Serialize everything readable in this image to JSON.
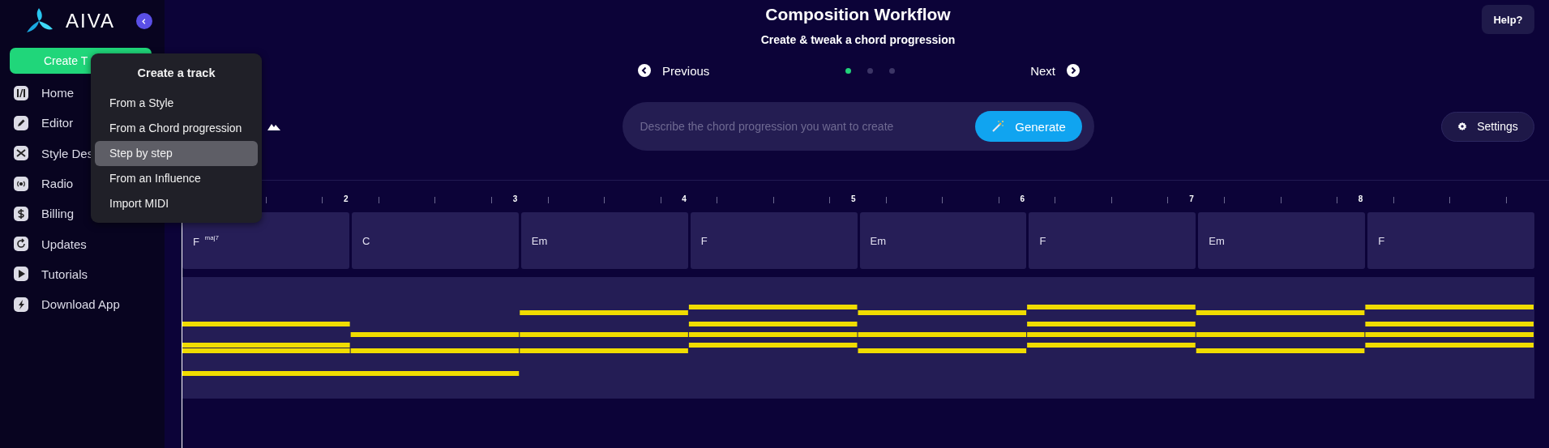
{
  "sidebar": {
    "brand": "AIVA",
    "create_button": "Create T",
    "items": [
      {
        "label": "Home"
      },
      {
        "label": "Editor"
      },
      {
        "label": "Style Des"
      },
      {
        "label": "Radio"
      },
      {
        "label": "Billing"
      },
      {
        "label": "Updates"
      },
      {
        "label": "Tutorials"
      },
      {
        "label": "Download App"
      }
    ]
  },
  "create_menu": {
    "title": "Create a track",
    "items": [
      {
        "label": "From a Style",
        "selected": false
      },
      {
        "label": "From a Chord progression",
        "selected": false
      },
      {
        "label": "Step by step",
        "selected": true
      },
      {
        "label": "From an Influence",
        "selected": false
      },
      {
        "label": "Import MIDI",
        "selected": false
      }
    ]
  },
  "header": {
    "title": "Composition Workflow",
    "subtitle": "Create & tweak a chord progression",
    "help_button": "Help?"
  },
  "wizard_nav": {
    "previous": "Previous",
    "next": "Next",
    "steps": [
      {
        "selected": true
      },
      {
        "selected": false
      },
      {
        "selected": false
      }
    ]
  },
  "prompt": {
    "placeholder": "Describe the chord progression you want to create",
    "generate_button": "Generate"
  },
  "settings_button": "Settings",
  "ruler": [
    "2",
    "3",
    "4",
    "5",
    "6",
    "7",
    "8"
  ],
  "chords": [
    {
      "name": "F $^{maj7}$"
    },
    {
      "name": "C"
    },
    {
      "name": "Em"
    },
    {
      "name": "F"
    },
    {
      "name": "Em"
    },
    {
      "name": "F"
    },
    {
      "name": "Em"
    },
    {
      "name": "F"
    }
  ]
}
